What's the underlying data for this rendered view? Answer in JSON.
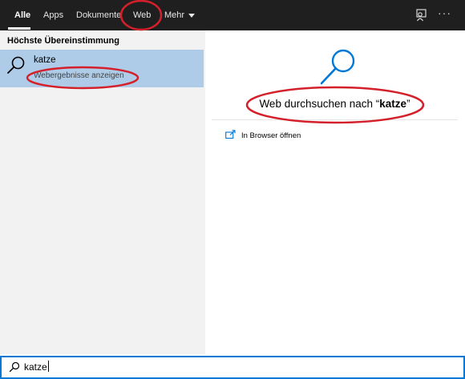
{
  "tabs": [
    {
      "label": "Alle",
      "active": true
    },
    {
      "label": "Apps"
    },
    {
      "label": "Dokumente"
    },
    {
      "label": "Web"
    },
    {
      "label": "Mehr"
    }
  ],
  "toolbar": {
    "feedback_icon": "feedback-icon",
    "more_icon": "ellipsis-icon",
    "more_glyph": "···"
  },
  "best_match": {
    "section_title": "Höchste Übereinstimmung",
    "title": "katze",
    "subtitle": "Webergebnisse anzeigen",
    "icon": "search-icon"
  },
  "preview": {
    "icon": "search-icon",
    "label_prefix": "Web durchsuchen nach “",
    "query": "katze",
    "label_suffix": "”",
    "action_label": "In Browser öffnen",
    "action_icon": "open-in-browser-icon"
  },
  "search": {
    "value": "katze",
    "icon": "search-icon"
  },
  "colors": {
    "topbar": "#1f1f1f",
    "left_pane": "#f2f2f2",
    "selected_row": "#aecbe7",
    "accent": "#0078d7",
    "annotation": "#d4202a"
  }
}
